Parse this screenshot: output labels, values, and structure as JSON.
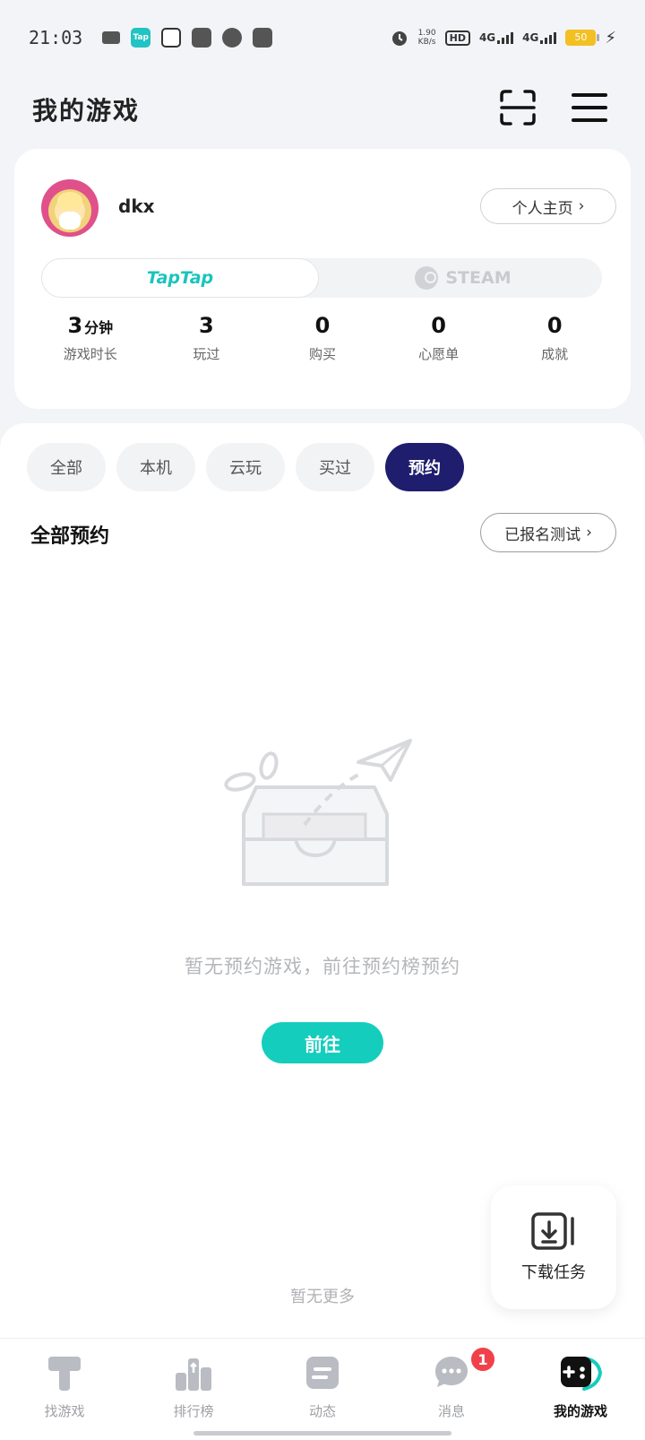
{
  "status_bar": {
    "time": "21:03",
    "net_speed_value": "1.90",
    "net_speed_unit": "KB/s",
    "hd": "HD",
    "signal_1": "4G",
    "signal_2": "4G",
    "battery": "50",
    "tap_icon_text": "Tap"
  },
  "header": {
    "title": "我的游戏"
  },
  "profile": {
    "username": "dkx",
    "homepage_label": "个人主页",
    "platforms": {
      "active": "TapTap",
      "inactive": "STEAM"
    },
    "stats": [
      {
        "value": "3",
        "unit": "分钟",
        "label": "游戏时长"
      },
      {
        "value": "3",
        "unit": "",
        "label": "玩过"
      },
      {
        "value": "0",
        "unit": "",
        "label": "购买"
      },
      {
        "value": "0",
        "unit": "",
        "label": "心愿单"
      },
      {
        "value": "0",
        "unit": "",
        "label": "成就"
      }
    ]
  },
  "filters": [
    "全部",
    "本机",
    "云玩",
    "买过",
    "预约"
  ],
  "active_filter": "预约",
  "section": {
    "title": "全部预约",
    "tested_button": "已报名测试"
  },
  "empty_state": {
    "message": "暂无预约游戏，前往预约榜预约",
    "button": "前往"
  },
  "download_fab": {
    "label": "下载任务"
  },
  "no_more": "暂无更多",
  "bottom_nav": [
    {
      "label": "找游戏",
      "icon": "find-game-icon"
    },
    {
      "label": "排行榜",
      "icon": "leaderboard-icon"
    },
    {
      "label": "动态",
      "icon": "feed-icon"
    },
    {
      "label": "消息",
      "icon": "message-icon",
      "badge": "1"
    },
    {
      "label": "我的游戏",
      "icon": "my-games-icon"
    }
  ],
  "colors": {
    "accent": "#15cdbd",
    "active_chip": "#1f1d6e",
    "badge": "#f0414a"
  }
}
